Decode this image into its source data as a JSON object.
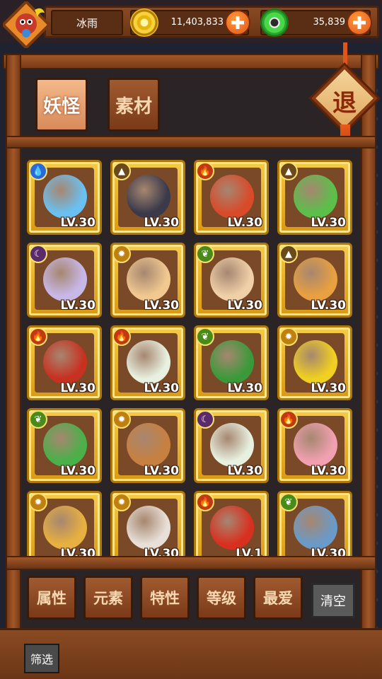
{
  "player": {
    "name": "冰雨",
    "avatar_icon": "dragon-avatar-icon"
  },
  "currencies": [
    {
      "name": "gold",
      "value": "11,403,833",
      "icon": "gold-coin-icon"
    },
    {
      "name": "jade",
      "value": "35,839",
      "icon": "jade-coin-icon"
    }
  ],
  "tabs": [
    {
      "label": "妖怪",
      "active": true
    },
    {
      "label": "素材",
      "active": false
    }
  ],
  "exit_label": "退",
  "element_icons": {
    "water": "💧",
    "earth": "▲",
    "fire": "🔥",
    "moon": "☾",
    "sun": "✹",
    "wood": "❦"
  },
  "cards": [
    {
      "element": "water",
      "level": "LV.30",
      "color": "#6ac0f0"
    },
    {
      "element": "earth",
      "level": "LV.30",
      "color": "#3a3a4a"
    },
    {
      "element": "fire",
      "level": "LV.30",
      "color": "#d84a2a"
    },
    {
      "element": "earth",
      "level": "LV.30",
      "color": "#5ac04a"
    },
    {
      "element": "moon",
      "level": "LV.30",
      "color": "#c8b8e8"
    },
    {
      "element": "sun",
      "level": "LV.30",
      "color": "#f0c890"
    },
    {
      "element": "wood",
      "level": "LV.30",
      "color": "#f0d0a8"
    },
    {
      "element": "earth",
      "level": "LV.30",
      "color": "#e8a040"
    },
    {
      "element": "fire",
      "level": "LV.30",
      "color": "#c83020"
    },
    {
      "element": "fire",
      "level": "LV.30",
      "color": "#e8f0e0"
    },
    {
      "element": "wood",
      "level": "LV.30",
      "color": "#3a9a3a"
    },
    {
      "element": "sun",
      "level": "LV.30",
      "color": "#f0d020"
    },
    {
      "element": "wood",
      "level": "LV.30",
      "color": "#4ab04a"
    },
    {
      "element": "sun",
      "level": "LV.30",
      "color": "#c88040"
    },
    {
      "element": "moon",
      "level": "LV.30",
      "color": "#e8f0e0"
    },
    {
      "element": "fire",
      "level": "LV.30",
      "color": "#f0a0b0"
    },
    {
      "element": "sun",
      "level": "LV.30",
      "color": "#e8b040"
    },
    {
      "element": "sun",
      "level": "LV.30",
      "color": "#e8e0d8"
    },
    {
      "element": "fire",
      "level": "LV.1",
      "color": "#d83020"
    },
    {
      "element": "wood",
      "level": "LV.30",
      "color": "#6a9ac8"
    }
  ],
  "filters": [
    "属性",
    "元素",
    "特性",
    "等级",
    "最爱"
  ],
  "clear_label": "清空",
  "screen_label": "筛选"
}
